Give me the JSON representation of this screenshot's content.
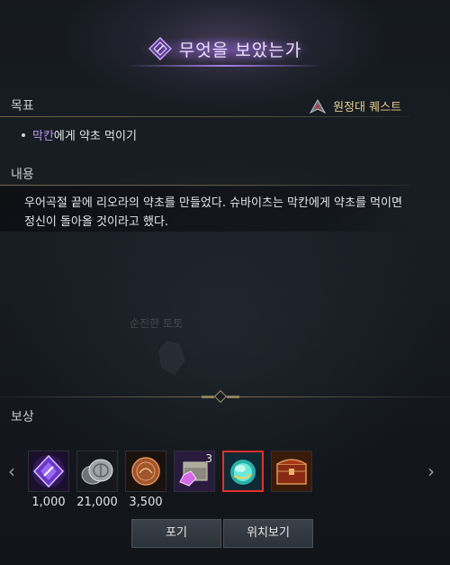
{
  "title": "무엇을 보았는가",
  "objective": {
    "label": "목표",
    "quest_type": "원정대 퀘스트",
    "item_npc": "막칸",
    "item_rest": "에게 약초 먹이기"
  },
  "content": {
    "label": "내용",
    "text": "우어곡절 끝에 리오라의 약초를 만들었다. 슈바이츠는 막칸에게 약초를 먹이면 정신이 돌아올 것이라고 했다."
  },
  "background_npc": "순진한 토토",
  "rewards": {
    "label": "보상",
    "items": [
      {
        "icon": "purple-crystal-icon",
        "count": "1,000"
      },
      {
        "icon": "silver-coins-icon",
        "count": "21,000"
      },
      {
        "icon": "bronze-coin-icon",
        "count": "3,500"
      },
      {
        "icon": "treasure-chest-gem-icon",
        "stack": "3",
        "count": ""
      },
      {
        "icon": "glowing-orb-icon",
        "count": "",
        "selected": true
      },
      {
        "icon": "red-chest-icon",
        "count": ""
      }
    ]
  },
  "buttons": {
    "give_up": "포기",
    "locate": "위치보기"
  },
  "colors": {
    "accent_purple": "#b89af0",
    "gold": "#e8cf8e",
    "selected_border": "#e4312a"
  }
}
